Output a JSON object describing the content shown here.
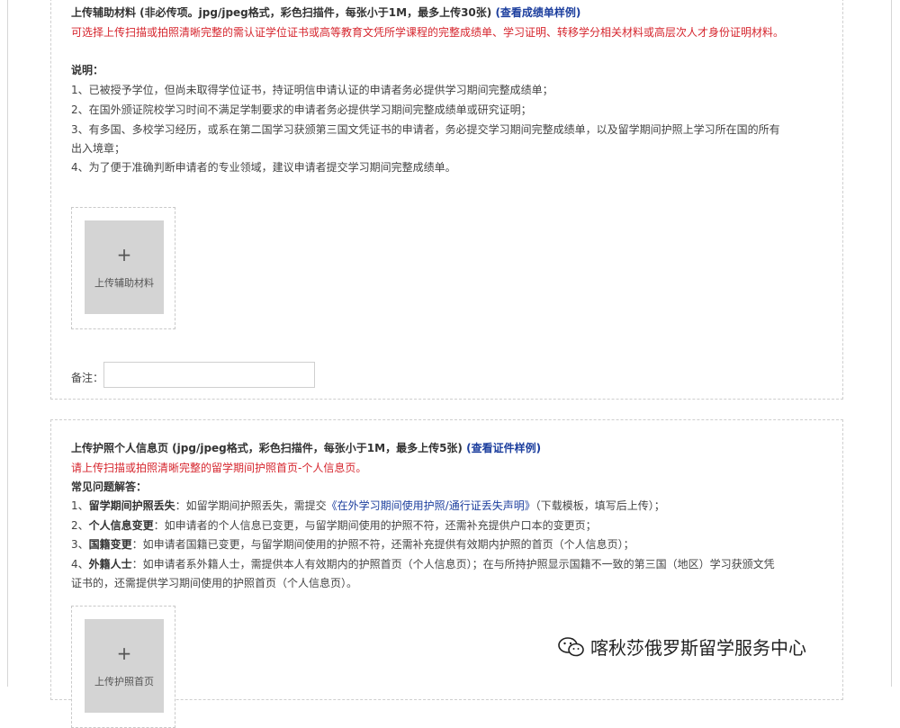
{
  "section1": {
    "title": "上传辅助材料 (非必传项。jpg/jpeg格式，彩色扫描件，每张小于1M，最多上传30张)",
    "title_link": "(查看成绩单样例)",
    "red_note": "可选择上传扫描或拍照清晰完整的需认证学位证书或高等教育文凭所学课程的完整成绩单、学习证明、转移学分相关材料或高层次人才身份证明材料。",
    "heading": "说明：",
    "lines": [
      "1、已被授予学位，但尚未取得学位证书，持证明信申请认证的申请者务必提供学习期间完整成绩单；",
      "2、在国外颁证院校学习时间不满足学制要求的申请者务必提供学习期间完整成绩单或研究证明；",
      "3、有多国、多校学习经历，或系在第二国学习获颁第三国文凭证书的申请者，务必提交学习期间完整成绩单，以及留学期间护照上学习所在国的所有",
      "出入境章；",
      "4、为了便于准确判断申请者的专业领域，建议申请者提交学习期间完整成绩单。"
    ],
    "upload_plus": "+",
    "upload_label": "上传辅助材料",
    "remark_label": "备注："
  },
  "section2": {
    "title": "上传护照个人信息页 (jpg/jpeg格式，彩色扫描件，每张小于1M，最多上传5张)",
    "title_link": "(查看证件样例)",
    "red_note": "请上传扫描或拍照清晰完整的留学期间护照首页-个人信息页。",
    "heading": "常见问题解答：",
    "q1_num": "1、",
    "q1_bold": "留学期间护照丢失",
    "q1_text": "：如留学期间护照丢失，需提交",
    "q1_link": "《在外学习期间使用护照/通行证丢失声明》",
    "q1_tail": "（下载模板，填写后上传）；",
    "q2_num": "2、",
    "q2_bold": "个人信息变更",
    "q2_text": "：如申请者的个人信息已变更，与留学期间使用的护照不符，还需补充提供户口本的变更页；",
    "q3_num": "3、",
    "q3_bold": "国籍变更",
    "q3_text": "：如申请者国籍已变更，与留学期间使用的护照不符，还需补充提供有效期内护照的首页（个人信息页）；",
    "q4_num": "4、",
    "q4_bold": "外籍人士",
    "q4_text": "：如申请者系外籍人士，需提供本人有效期内的护照首页（个人信息页）；在与所持护照显示国籍不一致的第三国（地区）学习获颁文凭",
    "q4_cont": "证书的，还需提供学习期间使用的护照首页（个人信息页）。",
    "upload_plus": "+",
    "upload_label": "上传护照首页"
  },
  "watermark": "喀秋莎俄罗斯留学服务中心"
}
